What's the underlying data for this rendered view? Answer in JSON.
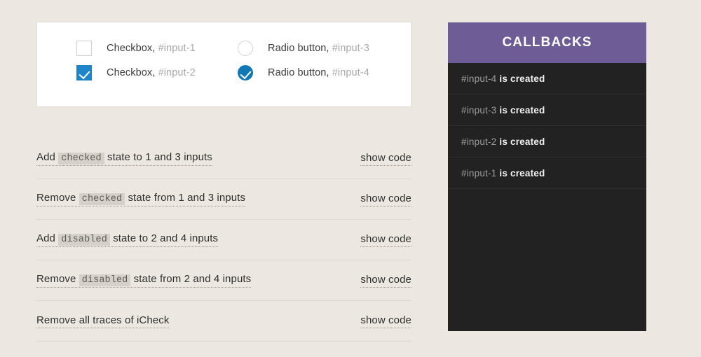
{
  "inputs_card": {
    "items": [
      {
        "id": "input-1",
        "type": "checkbox",
        "checked": false,
        "label": "Checkbox,",
        "ref": "#input-1"
      },
      {
        "id": "input-3",
        "type": "radio",
        "checked": false,
        "label": "Radio button,",
        "ref": "#input-3"
      },
      {
        "id": "input-2",
        "type": "checkbox",
        "checked": true,
        "label": "Checkbox,",
        "ref": "#input-2"
      },
      {
        "id": "input-4",
        "type": "radio",
        "checked": true,
        "label": "Radio button,",
        "ref": "#input-4"
      }
    ]
  },
  "actions": {
    "show_code_label": "show code",
    "rows": [
      {
        "pre": "Add",
        "chip": "checked",
        "post": "state to 1 and 3 inputs"
      },
      {
        "pre": "Remove",
        "chip": "checked",
        "post": "state from 1 and 3 inputs"
      },
      {
        "pre": "Add",
        "chip": "disabled",
        "post": "state to 2 and 4 inputs"
      },
      {
        "pre": "Remove",
        "chip": "disabled",
        "post": "state from 2 and 4 inputs"
      },
      {
        "pre": "Remove all traces of iCheck",
        "chip": "",
        "post": ""
      }
    ]
  },
  "callbacks": {
    "title": "CALLBACKS",
    "items": [
      {
        "id": "#input-4",
        "text": "is created"
      },
      {
        "id": "#input-3",
        "text": "is created"
      },
      {
        "id": "#input-2",
        "text": "is created"
      },
      {
        "id": "#input-1",
        "text": "is created"
      }
    ]
  },
  "colors": {
    "background": "#ece8e1",
    "card": "#ffffff",
    "accent_blue": "#1e86c8",
    "accent_radio": "#1278b5",
    "header_purple": "#6d5c95",
    "panel_dark": "#222222",
    "chip_bg": "#d5d1c8",
    "divider": "#ddd8ce"
  }
}
